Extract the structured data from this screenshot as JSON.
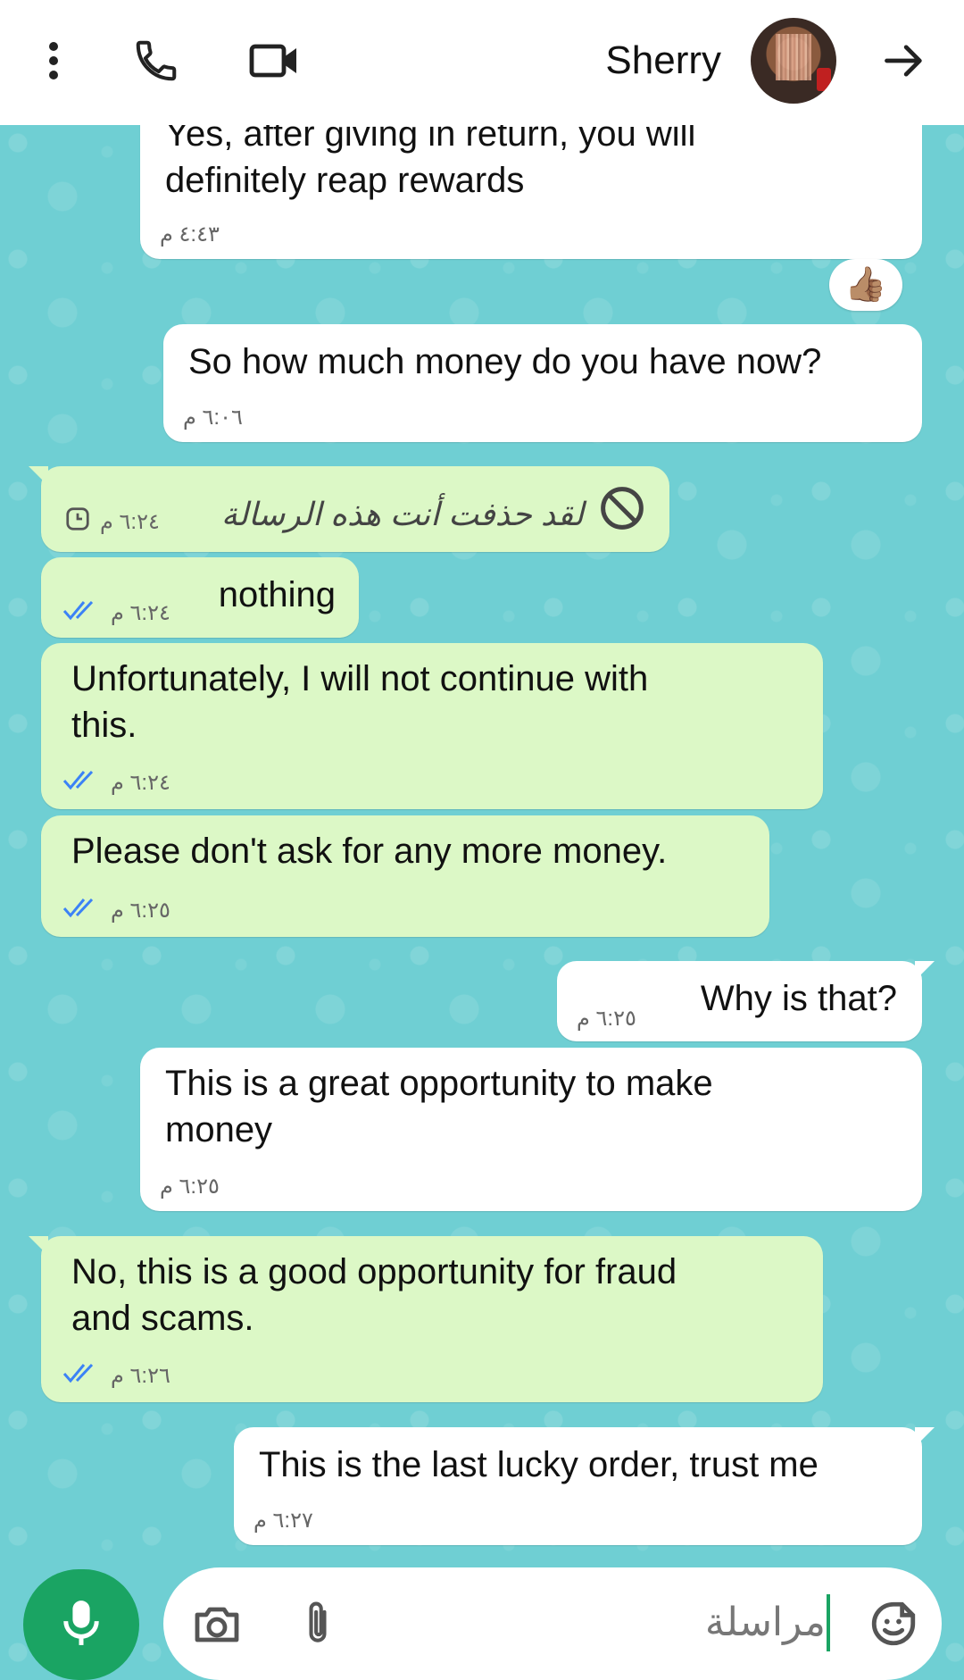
{
  "header": {
    "contact_name": "Sherry",
    "icons": [
      "more-vertical-icon",
      "phone-icon",
      "video-icon",
      "back-arrow-icon"
    ]
  },
  "messages": [
    {
      "side": "incoming",
      "text_line1": "Yes, after giving in return, you will",
      "text_line2": "definitely reap rewards",
      "time": "٤:٤٣ م"
    },
    {
      "side": "incoming",
      "text": "So how much money do you have now?",
      "time": "٦:٠٦ م",
      "reaction": "👍🏽"
    },
    {
      "side": "outgoing",
      "text": "لقد حذفت أنت هذه الرسالة",
      "time": "٦:٢٤ م",
      "deleted": true
    },
    {
      "side": "outgoing",
      "text": "nothing",
      "time": "٦:٢٤ م"
    },
    {
      "side": "outgoing",
      "text_line1": "Unfortunately, I will not continue with",
      "text_line2": "this.",
      "time": "٦:٢٤ م"
    },
    {
      "side": "outgoing",
      "text": "Please don't ask for any more money.",
      "time": "٦:٢٥ م"
    },
    {
      "side": "incoming",
      "text": "Why is that?",
      "time": "٦:٢٥ م"
    },
    {
      "side": "incoming",
      "text_line1": "This is a great opportunity to make",
      "text_line2": "money",
      "time": "٦:٢٥ م"
    },
    {
      "side": "outgoing",
      "text_line1": "No, this is a good opportunity for fraud",
      "text_line2": "and scams.",
      "time": "٦:٢٦ م"
    },
    {
      "side": "incoming",
      "text": "This is the last lucky order, trust me",
      "time": "٦:٢٧ م"
    }
  ],
  "composer": {
    "placeholder": "مراسلة"
  },
  "colors": {
    "wallpaper": "#6fcfd3",
    "outgoing_bubble": "#dcf8c6",
    "incoming_bubble": "#ffffff",
    "accent": "#1aa463",
    "read_ticks": "#3b82f6"
  }
}
